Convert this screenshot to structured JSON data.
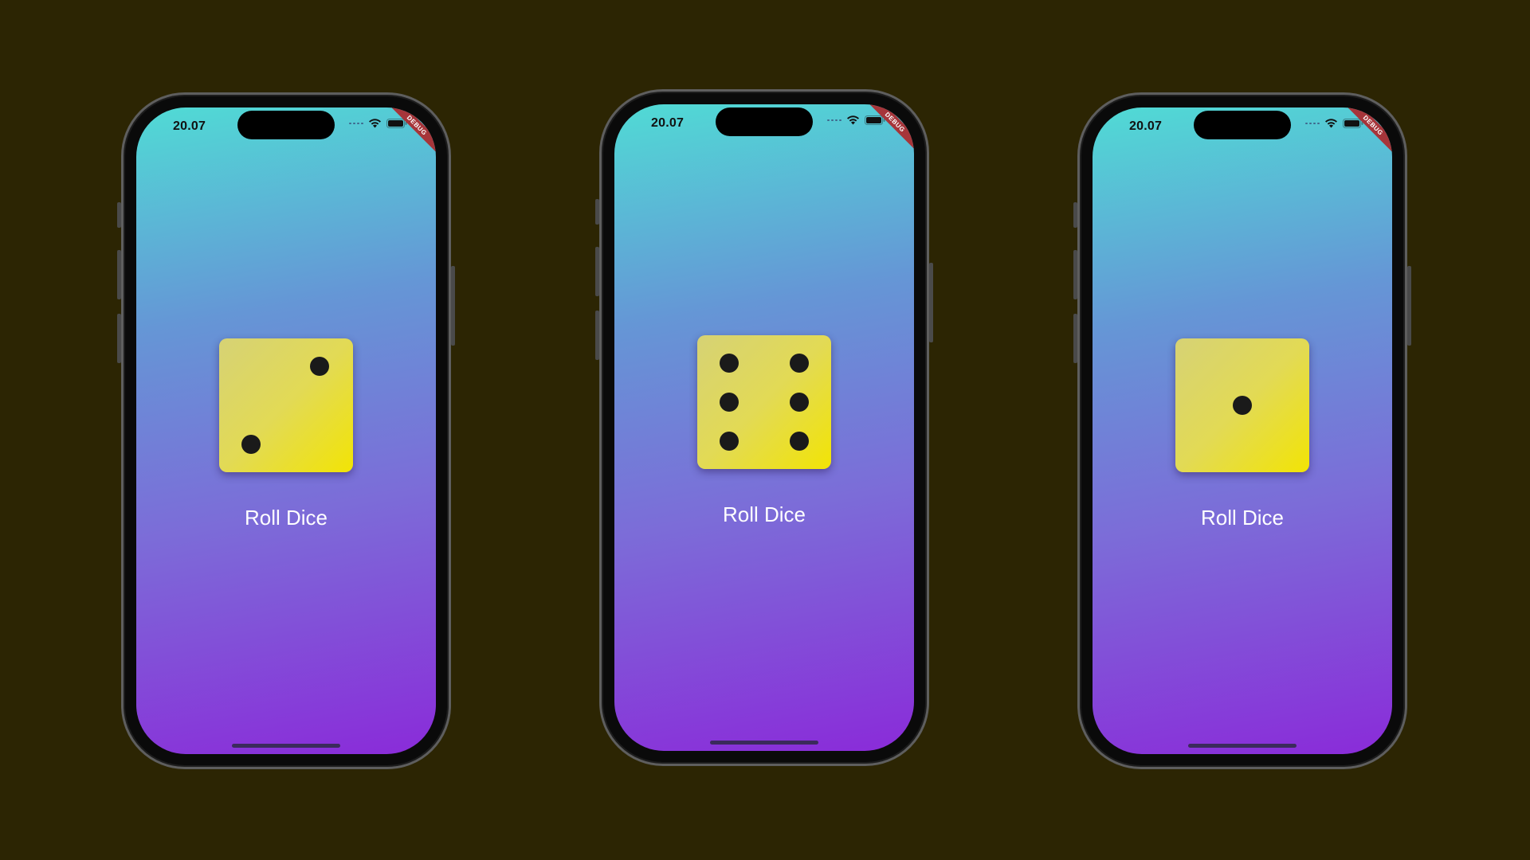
{
  "background_color": "#2c2503",
  "phones": [
    {
      "status_time": "20.07",
      "debug_label": "DEBUG",
      "dice_value": 2,
      "button_label": "Roll Dice"
    },
    {
      "status_time": "20.07",
      "debug_label": "DEBUG",
      "dice_value": 6,
      "button_label": "Roll Dice"
    },
    {
      "status_time": "20.07",
      "debug_label": "DEBUG",
      "dice_value": 1,
      "button_label": "Roll Dice"
    }
  ],
  "colors": {
    "gradient_top": "#50dbd5",
    "gradient_bottom": "#8a2bd9",
    "dice_face": "#e2da55",
    "pip": "#1a1a1a",
    "debug_ribbon": "#a6353a"
  },
  "icons": [
    "cellular-signal-icon",
    "wifi-icon",
    "battery-icon"
  ]
}
